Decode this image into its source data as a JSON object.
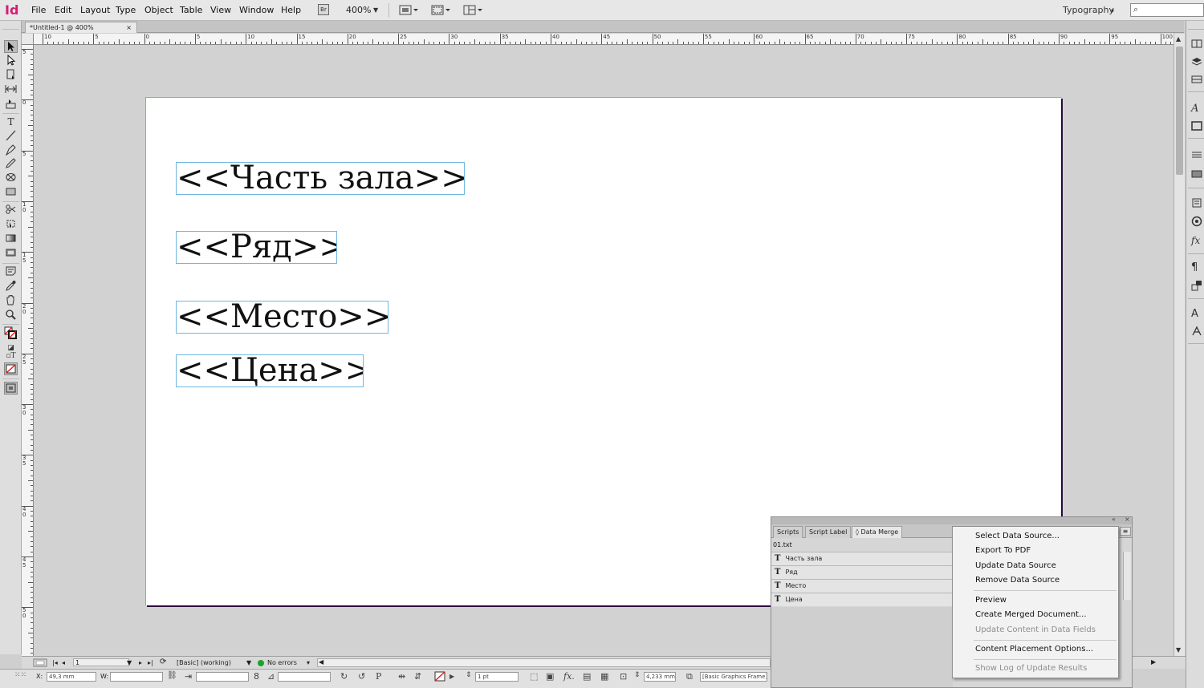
{
  "app": {
    "logo": "Id"
  },
  "menu": [
    "File",
    "Edit",
    "Layout",
    "Type",
    "Object",
    "Table",
    "View",
    "Window",
    "Help"
  ],
  "toolbar": {
    "bridge_label": "Br",
    "zoom": "400%"
  },
  "workspace": {
    "label": "Typography",
    "search_icon": "⌕"
  },
  "document": {
    "tab_title": "*Untitled-1 @ 400%",
    "close_glyph": "×"
  },
  "ruler": {
    "top_labels": [
      "10",
      "5",
      "0",
      "5",
      "10",
      "15",
      "20",
      "25",
      "30",
      "35",
      "40",
      "45",
      "50",
      "55",
      "60",
      "65",
      "70",
      "75",
      "80",
      "85",
      "90",
      "95",
      "100"
    ],
    "left_labels": [
      "5",
      "0",
      "5",
      "1 0",
      "1 5",
      "2 0",
      "2 5",
      "3 0",
      "3 5",
      "4 0",
      "4 5",
      "5 0"
    ]
  },
  "frames": [
    {
      "text": "<<Часть зала>>"
    },
    {
      "text": "<<Ряд>>"
    },
    {
      "text": "<<Место>>"
    },
    {
      "text": "<<Цена>>"
    }
  ],
  "status": {
    "page": "1",
    "style": "[Basic] (working)",
    "preflight": "No errors"
  },
  "control": {
    "x_label": "X:",
    "x_value": "49,3 mm",
    "w_label": "W:",
    "stroke_weight": "1 pt",
    "offset_value": "4,233 mm",
    "object_style": "[Basic Graphics Frame]"
  },
  "panel": {
    "tabs": [
      "Scripts",
      "Script Label",
      "◊ Data Merge"
    ],
    "source": "01.txt",
    "fields": [
      "Часть зала",
      "Ряд",
      "Место",
      "Цена"
    ],
    "field_glyph": "T",
    "collapse_glyph": "«",
    "close_glyph": "×",
    "menu_glyph": "≡"
  },
  "flyout": {
    "items": [
      {
        "label": "Select Data Source..."
      },
      {
        "label": "Export To PDF"
      },
      {
        "label": "Update Data Source"
      },
      {
        "label": "Remove Data Source"
      },
      {
        "label": "Preview"
      },
      {
        "label": "Create Merged Document..."
      },
      {
        "label": "Update Content in Data Fields"
      },
      {
        "label": "Content Placement Options..."
      },
      {
        "label": "Show Log of Update Results"
      }
    ]
  }
}
